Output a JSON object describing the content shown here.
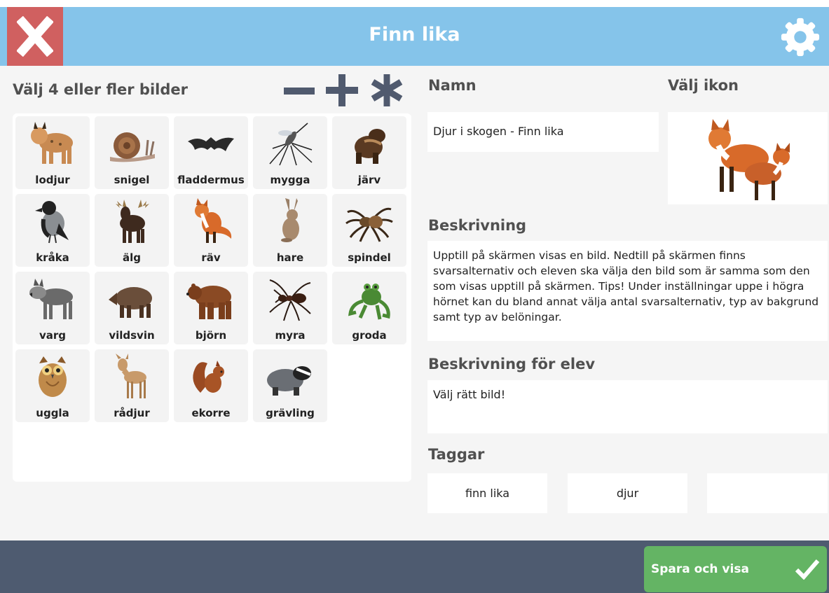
{
  "header": {
    "title": "Finn lika",
    "close_label": "X"
  },
  "picker": {
    "heading": "Välj 4 eller fler bilder",
    "items": [
      {
        "label": "lodjur"
      },
      {
        "label": "snigel"
      },
      {
        "label": "fladdermus"
      },
      {
        "label": "mygga"
      },
      {
        "label": "järv"
      },
      {
        "label": "kråka"
      },
      {
        "label": "älg"
      },
      {
        "label": "räv"
      },
      {
        "label": "hare"
      },
      {
        "label": "spindel"
      },
      {
        "label": "varg"
      },
      {
        "label": "vildsvin"
      },
      {
        "label": "björn"
      },
      {
        "label": "myra"
      },
      {
        "label": "groda"
      },
      {
        "label": "uggla"
      },
      {
        "label": "rådjur"
      },
      {
        "label": "ekorre"
      },
      {
        "label": "grävling"
      }
    ]
  },
  "form": {
    "name_heading": "Namn",
    "name_value": "Djur i skogen - Finn lika",
    "icon_heading": "Välj ikon",
    "description_heading": "Beskrivning",
    "description_value": "Upptill på skärmen visas en bild. Nedtill på skärmen finns svarsalternativ och eleven ska välja den bild som är samma som den som visas upptill på skärmen. Tips! Under inställningar uppe i högra hörnet kan du bland annat välja antal svarsalternativ, typ av bakgrund samt typ av belöningar.",
    "student_description_heading": "Beskrivning för elev",
    "student_description_value": "Välj rätt bild!",
    "tags_heading": "Taggar",
    "tags": [
      "finn lika",
      "djur",
      ""
    ]
  },
  "footer": {
    "save_label": "Spara och visa"
  },
  "colors": {
    "header": "#85c4ea",
    "close": "#d06060",
    "footer": "#4e5b70",
    "save": "#64b464",
    "heading_text": "#505050"
  }
}
